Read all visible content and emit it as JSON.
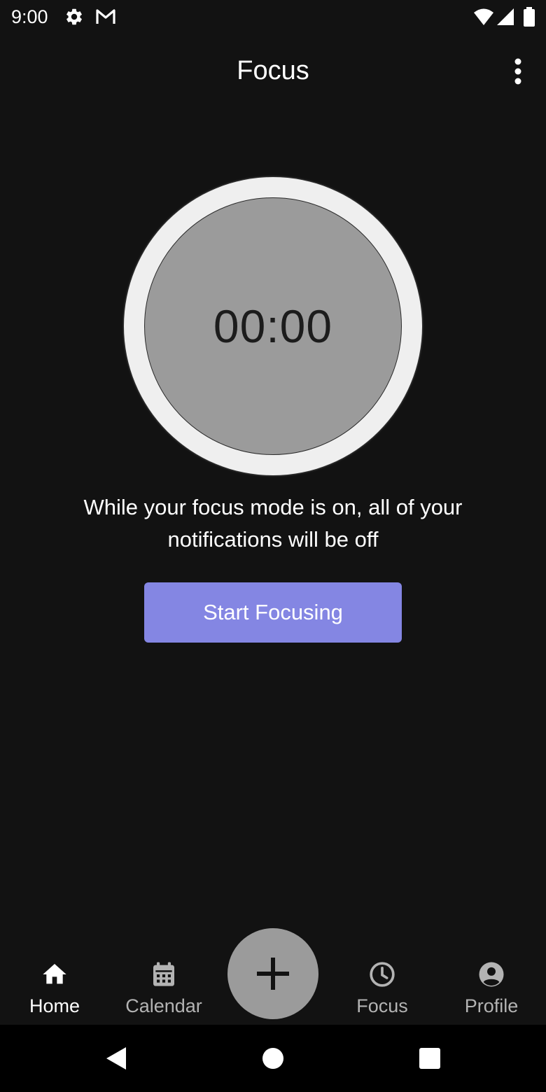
{
  "status_bar": {
    "time": "9:00",
    "icons": [
      "gear-icon",
      "gmail-icon",
      "wifi-icon",
      "signal-icon",
      "battery-icon"
    ]
  },
  "app_bar": {
    "title": "Focus",
    "menu_icon": "more-vert-icon"
  },
  "timer": {
    "display": "00:00"
  },
  "message": "While your focus mode is on, all of your notifications will be off",
  "start_button": {
    "label": "Start Focusing"
  },
  "bottom_nav": {
    "items": [
      {
        "label": "Home",
        "icon": "home-icon",
        "active": true
      },
      {
        "label": "Calendar",
        "icon": "calendar-icon",
        "active": false
      },
      {
        "label": "Focus",
        "icon": "clock-icon",
        "active": false
      },
      {
        "label": "Profile",
        "icon": "profile-icon",
        "active": false
      }
    ],
    "fab_icon": "plus-icon"
  },
  "system_nav": {
    "icons": [
      "back-icon",
      "home-circle-icon",
      "recents-icon"
    ]
  },
  "colors": {
    "background": "#121212",
    "accent": "#8486E3",
    "timer_ring": "#EFEFEF",
    "timer_face": "#9B9B9B",
    "nav_active": "#FFFFFF",
    "nav_inactive": "#B3B3B3"
  }
}
